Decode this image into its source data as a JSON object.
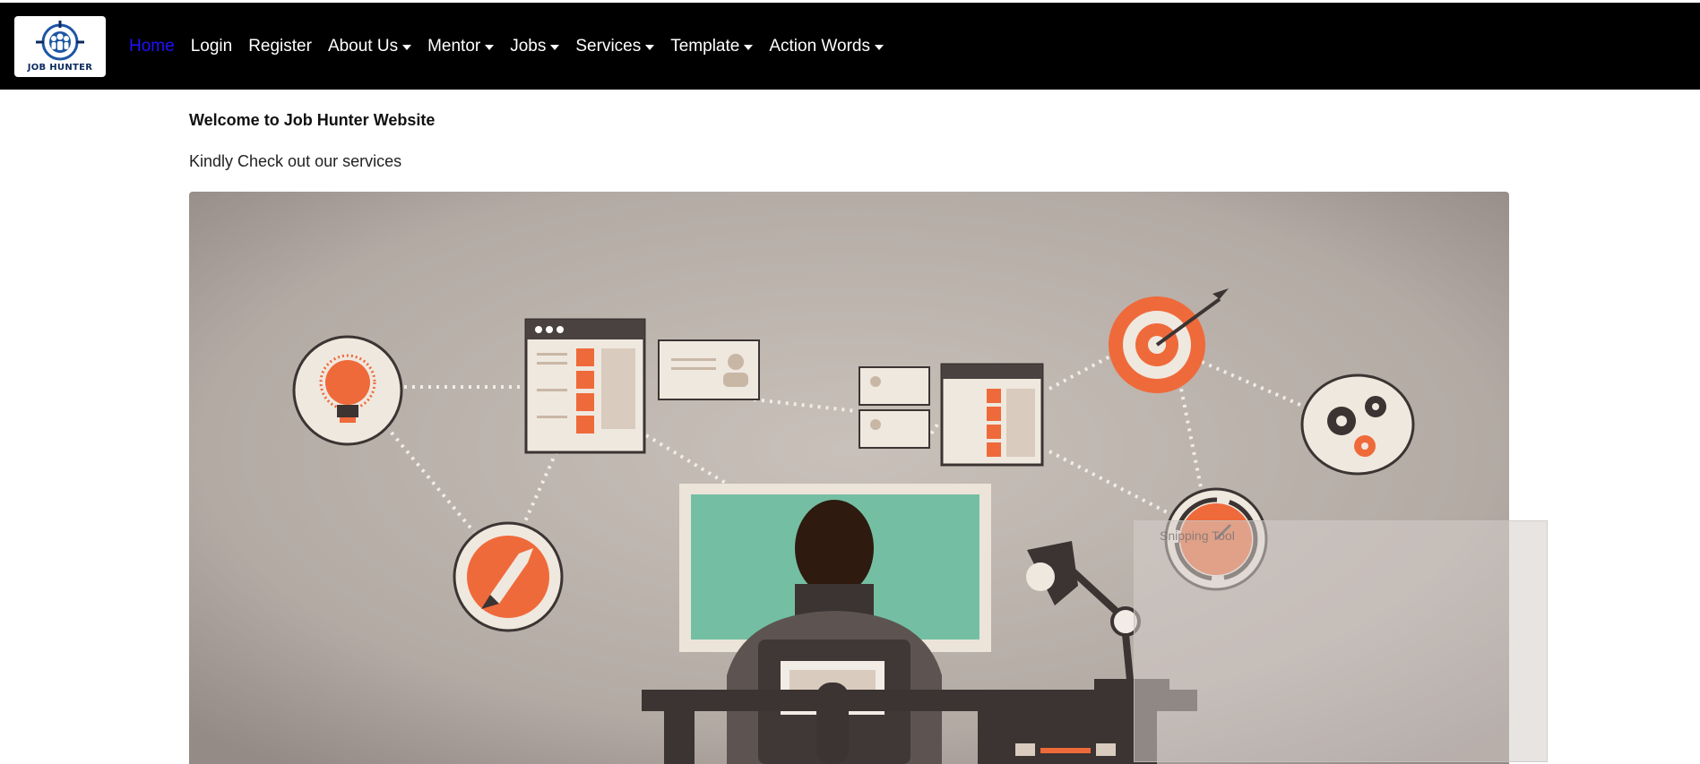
{
  "brand": {
    "text": "JOB HUNTER",
    "logo_icon": "target-people-icon"
  },
  "nav": {
    "items": [
      {
        "label": "Home",
        "active": true,
        "dropdown": false
      },
      {
        "label": "Login",
        "active": false,
        "dropdown": false
      },
      {
        "label": "Register",
        "active": false,
        "dropdown": false
      },
      {
        "label": "About Us",
        "active": false,
        "dropdown": true
      },
      {
        "label": "Mentor",
        "active": false,
        "dropdown": true
      },
      {
        "label": "Jobs",
        "active": false,
        "dropdown": true
      },
      {
        "label": "Services",
        "active": false,
        "dropdown": true
      },
      {
        "label": "Template",
        "active": false,
        "dropdown": true
      },
      {
        "label": "Action Words",
        "active": false,
        "dropdown": true
      }
    ]
  },
  "main": {
    "welcome": "Welcome to Job Hunter Website",
    "subtitle": "Kindly Check out our services"
  },
  "overlay": {
    "label": "Snipping Tool"
  },
  "colors": {
    "navbar": "#000000",
    "active_link": "#1f12ff",
    "accent_orange": "#ef6a3a",
    "screen_teal": "#74bfa3",
    "hero_bg": "#b7aea8"
  }
}
